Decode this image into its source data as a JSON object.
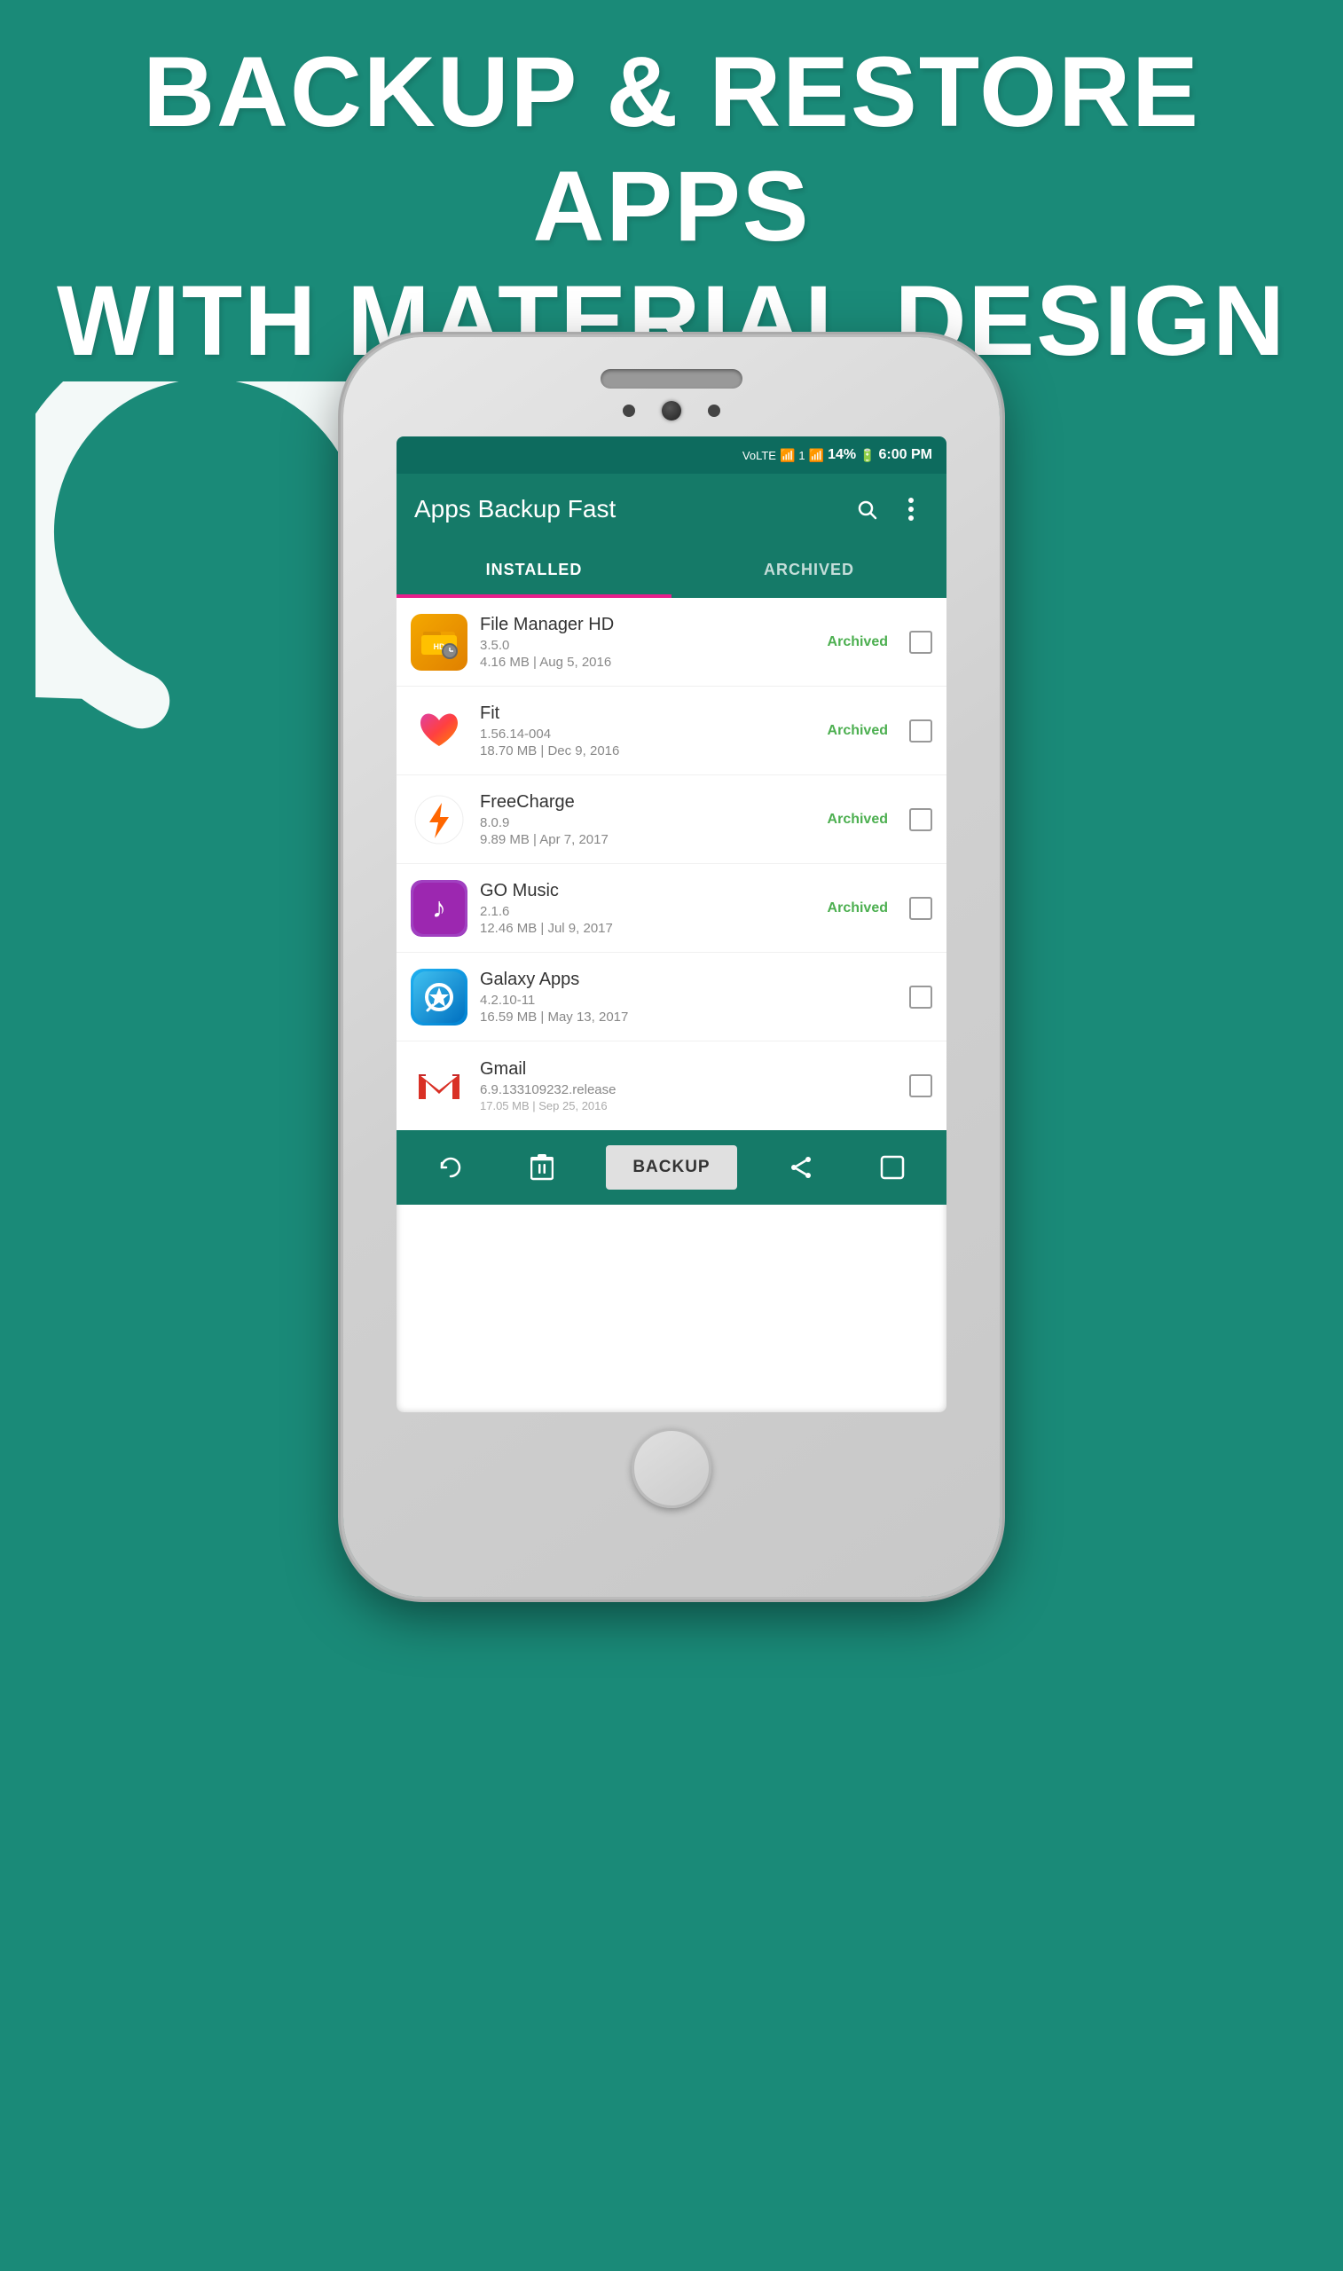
{
  "hero": {
    "line1": "BACKUP & RESTORE APPS",
    "line2": "WITH MATERIAL DESIGN"
  },
  "statusBar": {
    "battery": "14%",
    "time": "6:00 PM",
    "signal": "VoLTE",
    "wifi": "WiFi",
    "batteryIcon": "🔋"
  },
  "appBar": {
    "title": "Apps Backup Fast",
    "searchIcon": "search",
    "menuIcon": "more_vert"
  },
  "tabs": [
    {
      "label": "INSTALLED",
      "active": true
    },
    {
      "label": "ARCHIVED",
      "active": false
    }
  ],
  "apps": [
    {
      "name": "File Manager HD",
      "version": "3.5.0",
      "size": "4.16 MB",
      "date": "Aug 5, 2016",
      "archived": true,
      "checked": false,
      "iconType": "filemanager"
    },
    {
      "name": "Fit",
      "version": "1.56.14-004",
      "size": "18.70 MB",
      "date": "Dec 9, 2016",
      "archived": true,
      "checked": false,
      "iconType": "fit"
    },
    {
      "name": "FreeCharge",
      "version": "8.0.9",
      "size": "9.89 MB",
      "date": "Apr 7, 2017",
      "archived": true,
      "checked": false,
      "iconType": "freecharge"
    },
    {
      "name": "GO Music",
      "version": "2.1.6",
      "size": "12.46 MB",
      "date": "Jul 9, 2017",
      "archived": true,
      "checked": false,
      "iconType": "gomusic"
    },
    {
      "name": "Galaxy Apps",
      "version": "4.2.10-11",
      "size": "16.59 MB",
      "date": "May 13, 2017",
      "archived": false,
      "checked": false,
      "iconType": "galaxy"
    },
    {
      "name": "Gmail",
      "version": "6.9.133109232.release",
      "size": "17.05 MB",
      "date": "Sep 25, 2016",
      "archived": false,
      "checked": false,
      "iconType": "gmail"
    }
  ],
  "bottomBar": {
    "refreshLabel": "↺",
    "deleteLabel": "🗑",
    "backupLabel": "BACKUP",
    "shareLabel": "⬆",
    "selectLabel": "☐"
  },
  "archivedLabel": "Archived"
}
